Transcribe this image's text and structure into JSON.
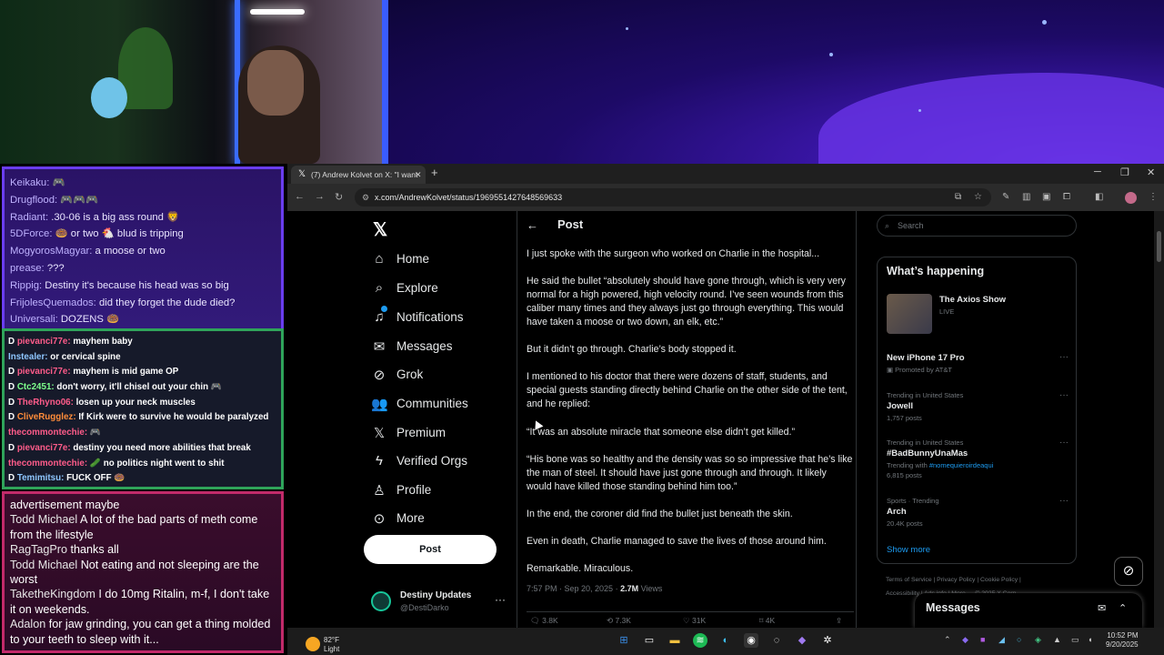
{
  "chat_top": [
    {
      "user": "Keikaku:",
      "text": " 🎮"
    },
    {
      "user": "Drugflood:",
      "text": " 🎮🎮🎮"
    },
    {
      "user": "Radiant:",
      "text": " .30-06 is a big ass round 🦁"
    },
    {
      "user": "5DForce:",
      "text": " 🍩 or two 🐔 blud is tripping"
    },
    {
      "user": "MogyorosMagyar:",
      "text": " a moose or two"
    },
    {
      "user": "prease:",
      "text": " ???"
    },
    {
      "user": "Rippig:",
      "text": " Destiny it's because his head was so big"
    },
    {
      "user": "FrijolesQuemados:",
      "text": " did they forget the dude died?"
    },
    {
      "user": "Universali:",
      "text": " DOZENS 🍩"
    }
  ],
  "chat_mid": [
    {
      "user": "pievanci77e:",
      "text": " mayhem baby",
      "cls": "u"
    },
    {
      "user": "Instealer:",
      "text": " or cervical spine",
      "cls": "u blue"
    },
    {
      "user": "pievanci77e:",
      "text": " mayhem is mid game OP",
      "cls": "u"
    },
    {
      "user": "Ctc2451:",
      "text": " don't worry, it'll chisel out your chin 🎮",
      "cls": "u grn"
    },
    {
      "user": "TheRhyno06:",
      "text": " losen up your neck muscles",
      "cls": "u"
    },
    {
      "user": "CliveRugglez:",
      "text": " If Kirk were to survive he would be paralyzed",
      "cls": "u alt"
    },
    {
      "user": "thecommontechie:",
      "text": " 🎮",
      "cls": "u"
    },
    {
      "user": "pievanci77e:",
      "text": " destiny you need more abilities that break",
      "cls": "u"
    },
    {
      "user": "thecommontechie:",
      "text": " 🥒 no politics night went to shit",
      "cls": "u"
    },
    {
      "user": "Temimitsu:",
      "text": " FUCK OFF 🍩",
      "cls": "u blue"
    }
  ],
  "chat_bot": [
    {
      "user": "",
      "text": "advertisement maybe"
    },
    {
      "user": "Todd Michael",
      "text": " A lot of the bad parts of meth come from the lifestyle"
    },
    {
      "user": "RagTagPro",
      "text": " thanks all"
    },
    {
      "user": "Todd Michael",
      "text": " Not eating and not sleeping are the worst"
    },
    {
      "user": "TaketheKingdom",
      "text": " I do 10mg Ritalin, m-f, I don't take it on weekends."
    },
    {
      "user": "Adalon",
      "text": " for jaw grinding, you can get a thing molded to your teeth to sleep with it..."
    }
  ],
  "browser": {
    "tab_title": "(7) Andrew Kolvet on X: \"I want",
    "url": "x.com/AndrewKolvet/status/1969551427648569633"
  },
  "nav": {
    "home": "Home",
    "explore": "Explore",
    "notifications": "Notifications",
    "messages": "Messages",
    "grok": "Grok",
    "communities": "Communities",
    "premium": "Premium",
    "verified": "Verified Orgs",
    "profile": "Profile",
    "more": "More",
    "post_button": "Post"
  },
  "account": {
    "name": "Destiny Updates",
    "handle": "@DestiDarko"
  },
  "post": {
    "header": "Post",
    "paragraphs": [
      "I just spoke with the surgeon who worked on Charlie in the hospital...",
      "He said the bullet “absolutely should have gone through, which is very very normal for a high powered, high velocity round. I’ve seen wounds from this caliber many times and they always just go through everything. This would have taken a moose or two down, an elk, etc.”",
      "But it didn’t go through. Charlie’s body stopped it.",
      "I mentioned to his doctor that there were dozens of staff, students, and special guests standing directly behind Charlie on the other side of the tent, and he replied:",
      "“It was an absolute miracle that someone else didn’t get killed.”",
      "“His bone was so healthy and the density was so so impressive that he’s like the man of steel. It should have just gone through and through. It likely would have killed those standing behind him too.”",
      "In the end, the coroner did find the bullet just beneath the skin.",
      "Even in death, Charlie managed to save the lives of those around him.",
      "Remarkable. Miraculous."
    ],
    "time": "7:57 PM · Sep 20, 2025 · ",
    "views_count": "2.7M",
    "views_label": " Views",
    "replies": "3.8K",
    "reposts": "7.3K",
    "likes": "31K",
    "bookmarks": "4K"
  },
  "sidebar": {
    "search_placeholder": "Search",
    "whats_happening": "What’s happening",
    "axios_title": "The Axios Show",
    "axios_live": "LIVE",
    "promo_name": "New iPhone 17 Pro",
    "promo_sub": "Promoted by AT&T",
    "trends": [
      {
        "cat": "Trending in United States",
        "name": "Jowell",
        "sub": "1,757 posts"
      },
      {
        "cat": "Trending in United States",
        "name": "#BadBunnyUnaMas",
        "sub_prefix": "Trending with ",
        "sub_hash": "#nomequieroirdeaqui",
        "sub2": "6,815 posts"
      },
      {
        "cat": "Sports · Trending",
        "name": "Arch",
        "sub": "20.4K posts"
      }
    ],
    "show_more": "Show more",
    "footer1": "Terms of Service  |  Privacy Policy  |  Cookie Policy  |",
    "footer2": "Accessibility  |  Ads info  |  More ···  © 2025 X Corp.",
    "messages_dock": "Messages"
  },
  "taskbar": {
    "temp": "82°F",
    "weather": "Light rain",
    "time": "10:52 PM",
    "date": "9/20/2025"
  }
}
